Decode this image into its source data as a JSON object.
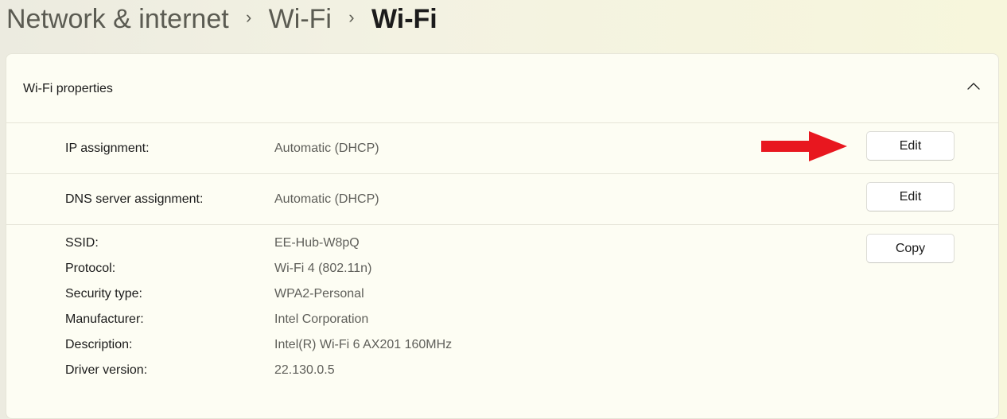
{
  "breadcrumb": {
    "items": [
      "Network & internet",
      "Wi-Fi",
      "Wi-Fi"
    ],
    "separator": "›"
  },
  "card": {
    "title": "Wi-Fi properties",
    "collapse_icon": "chevron-up-icon"
  },
  "ip_assignment": {
    "label": "IP assignment:",
    "value": "Automatic (DHCP)",
    "button": "Edit"
  },
  "dns_assignment": {
    "label": "DNS server assignment:",
    "value": "Automatic (DHCP)",
    "button": "Edit"
  },
  "properties": {
    "copy_button": "Copy",
    "items": [
      {
        "label": "SSID:",
        "value": "EE-Hub-W8pQ"
      },
      {
        "label": "Protocol:",
        "value": "Wi-Fi 4 (802.11n)"
      },
      {
        "label": "Security type:",
        "value": "WPA2-Personal"
      },
      {
        "label": "Manufacturer:",
        "value": "Intel Corporation"
      },
      {
        "label": "Description:",
        "value": "Intel(R) Wi-Fi 6 AX201 160MHz"
      },
      {
        "label": "Driver version:",
        "value": "22.130.0.5"
      }
    ]
  },
  "annotation": {
    "arrow_icon": "red-arrow-icon",
    "color": "#e8171f"
  }
}
